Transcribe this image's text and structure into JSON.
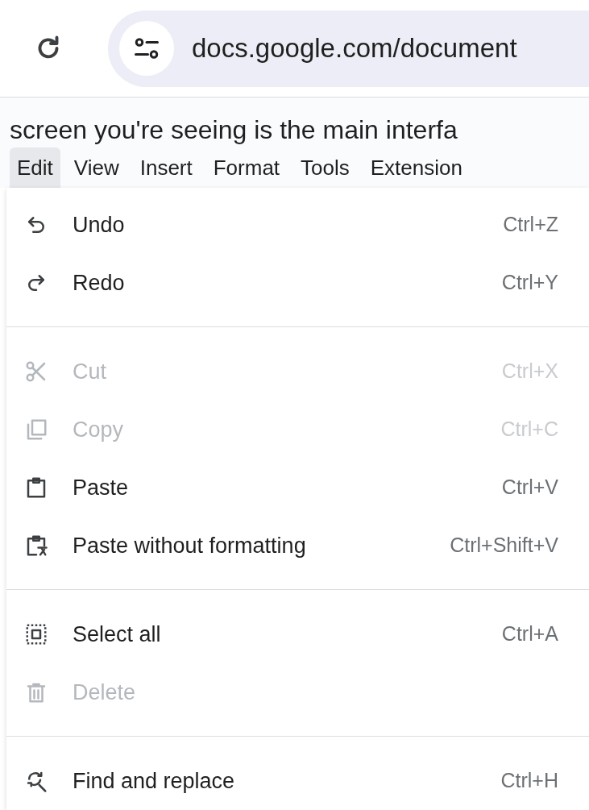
{
  "browser": {
    "url": "docs.google.com/document"
  },
  "document": {
    "text": "screen you're seeing is the main interfa"
  },
  "menu_bar": [
    {
      "label": "Edit",
      "selected": true
    },
    {
      "label": "View",
      "selected": false
    },
    {
      "label": "Insert",
      "selected": false
    },
    {
      "label": "Format",
      "selected": false
    },
    {
      "label": "Tools",
      "selected": false
    },
    {
      "label": "Extension",
      "selected": false
    }
  ],
  "edit_menu": {
    "sections": [
      [
        {
          "label": "Undo",
          "shortcut": "Ctrl+Z",
          "disabled": false
        },
        {
          "label": "Redo",
          "shortcut": "Ctrl+Y",
          "disabled": false
        }
      ],
      [
        {
          "label": "Cut",
          "shortcut": "Ctrl+X",
          "disabled": true
        },
        {
          "label": "Copy",
          "shortcut": "Ctrl+C",
          "disabled": true
        },
        {
          "label": "Paste",
          "shortcut": "Ctrl+V",
          "disabled": false
        },
        {
          "label": "Paste without formatting",
          "shortcut": "Ctrl+Shift+V",
          "disabled": false
        }
      ],
      [
        {
          "label": "Select all",
          "shortcut": "Ctrl+A",
          "disabled": false
        },
        {
          "label": "Delete",
          "disabled": true
        }
      ],
      [
        {
          "label": "Find and replace",
          "shortcut": "Ctrl+H",
          "disabled": false
        }
      ]
    ]
  }
}
